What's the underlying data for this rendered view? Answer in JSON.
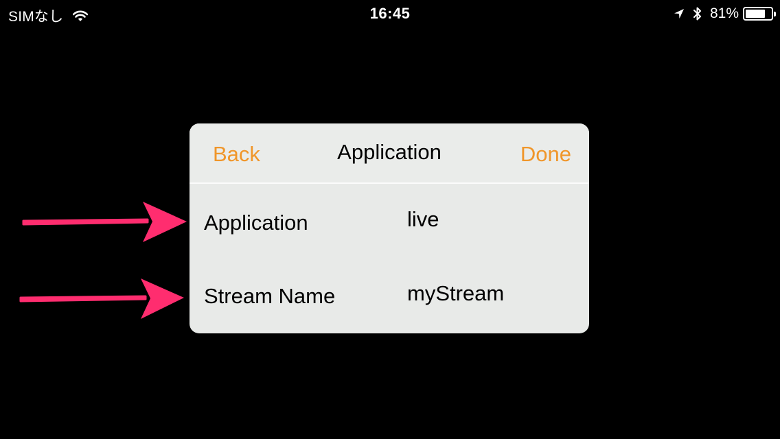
{
  "status_bar": {
    "carrier": "SIMなし",
    "time": "16:45",
    "battery_text": "81%",
    "battery_level": 0.81,
    "icons": [
      "wifi-icon",
      "location-arrow-icon",
      "bluetooth-icon",
      "battery-icon"
    ]
  },
  "dialog": {
    "back_label": "Back",
    "title": "Application",
    "done_label": "Done",
    "fields": [
      {
        "label": "Application",
        "value": "live"
      },
      {
        "label": "Stream Name",
        "value": "myStream"
      }
    ]
  },
  "annotations": {
    "arrow_color": "#ff2d6f",
    "arrow_icon": "pointer-arrow-icon"
  },
  "colors": {
    "background": "#000000",
    "dialog_background": "#e8eae8",
    "accent": "#f0962a",
    "text": "#000000"
  }
}
